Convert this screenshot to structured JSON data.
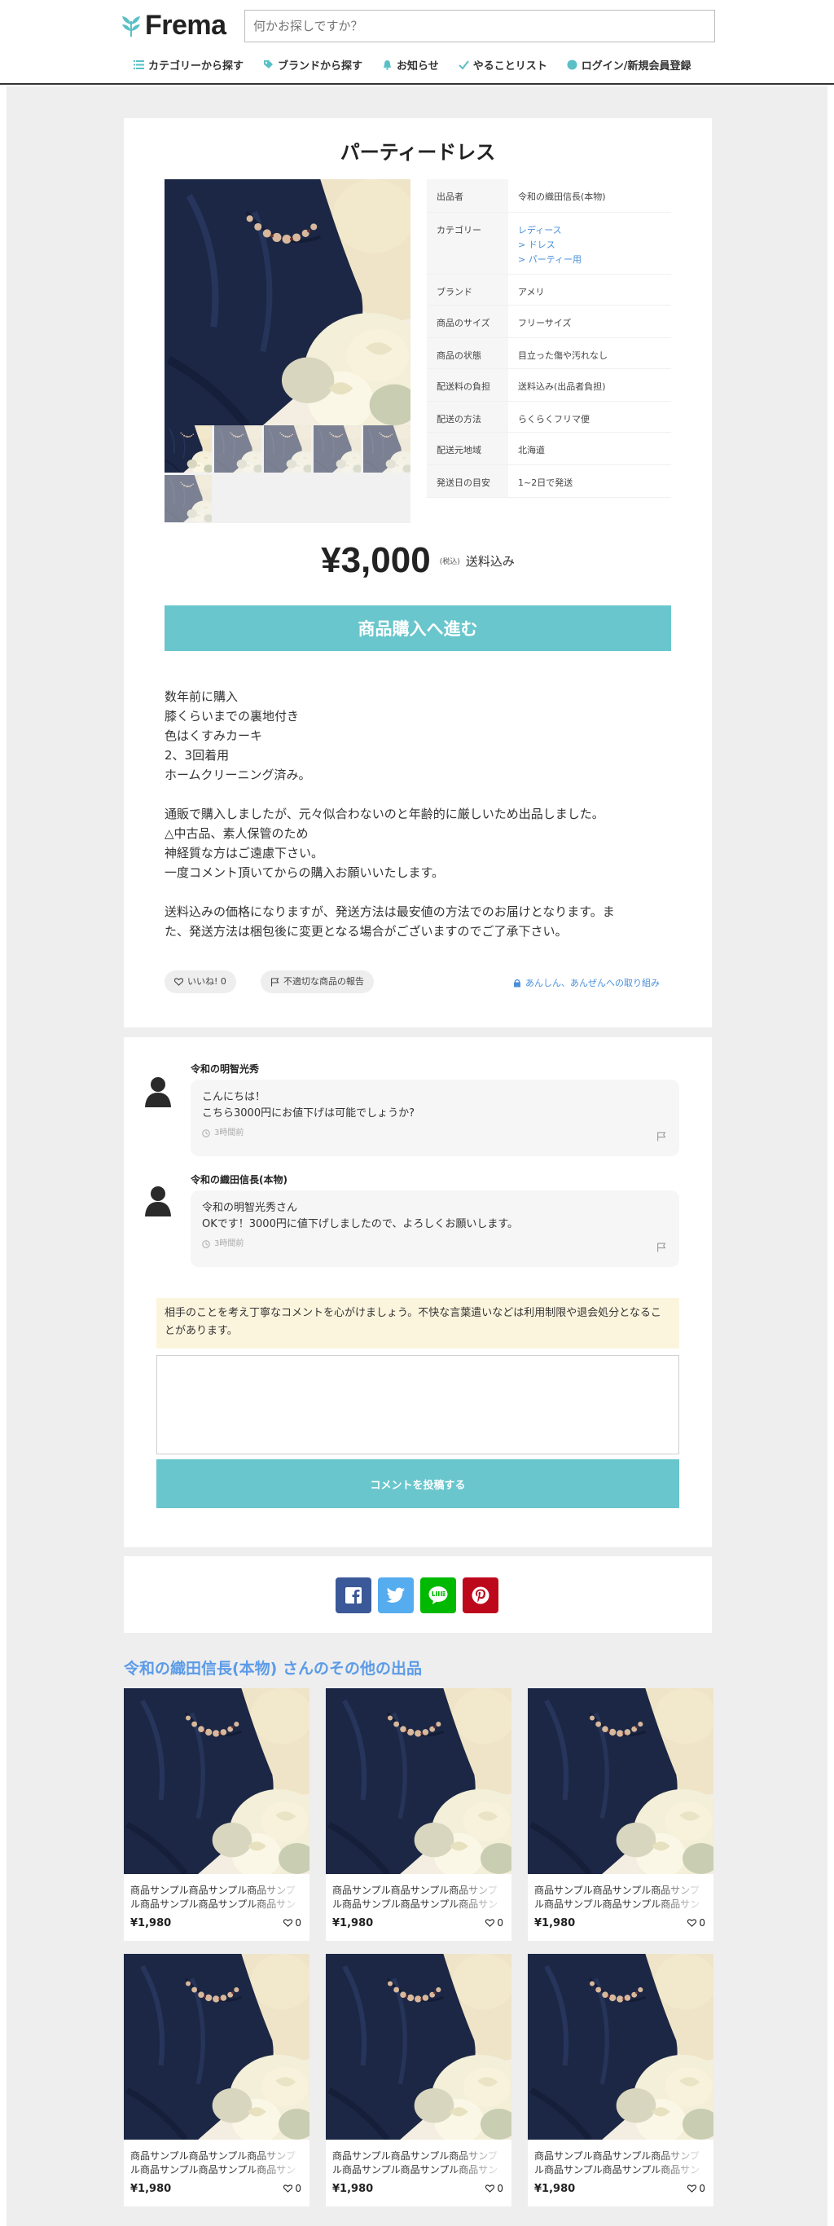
{
  "header": {
    "logo_text": "Frema",
    "search_placeholder": "何かお探しですか？",
    "nav": [
      {
        "label": "カテゴリーから探す"
      },
      {
        "label": "ブランドから探す"
      },
      {
        "label": "お知らせ"
      },
      {
        "label": "やることリスト"
      },
      {
        "label": "ログイン/新規会員登録"
      }
    ]
  },
  "product": {
    "title": "パーティードレス",
    "specs": [
      {
        "label": "出品者",
        "value": "令和の織田信長(本物)"
      },
      {
        "label": "カテゴリー",
        "links": [
          "レディース",
          "ドレス",
          "パーティー用"
        ]
      },
      {
        "label": "ブランド",
        "value": "アメリ"
      },
      {
        "label": "商品のサイズ",
        "value": "フリーサイズ"
      },
      {
        "label": "商品の状態",
        "value": "目立った傷や汚れなし"
      },
      {
        "label": "配送料の負担",
        "value": "送料込み(出品者負担)"
      },
      {
        "label": "配送の方法",
        "value": "らくらくフリマ便"
      },
      {
        "label": "配送元地域",
        "value": "北海道"
      },
      {
        "label": "発送日の目安",
        "value": "1~2日で発送"
      }
    ],
    "price": "¥3,000",
    "tax_label": "(税込)",
    "shipping_label": "送料込み",
    "buy_button": "商品購入へ進む",
    "description": [
      "数年前に購入",
      "膝くらいまでの裏地付き",
      "色はくすみカーキ",
      "2、3回着用",
      "ホームクリーニング済み。",
      "",
      "通販で購入しましたが、元々似合わないのと年齢的に厳しいため出品しました。",
      "△中古品、素人保管のため",
      "神経質な方はご遠慮下さい。",
      "一度コメント頂いてからの購入お願いいたします。",
      "",
      "送料込みの価格になりますが、発送方法は最安値の方法でのお届けとなります。ま",
      "た、発送方法は梱包後に変更となる場合がございますのでご了承下さい。"
    ],
    "like_label": "いいね! 0",
    "report_label": "不適切な商品の報告",
    "safe_label": "あんしん、あんぜんへの取り組み"
  },
  "comments": [
    {
      "name": "令和の明智光秀",
      "lines": [
        "こんにちは！",
        "こちら3000円にお値下げは可能でしょうか?"
      ],
      "time": "3時間前"
    },
    {
      "name": "令和の織田信長(本物)",
      "lines": [
        "令和の明智光秀さん",
        "OKです！3000円に値下げしましたので、よろしくお願いします。"
      ],
      "time": "3時間前"
    }
  ],
  "comment_form": {
    "notice": "相手のことを考え丁寧なコメントを心がけましょう。不快な言葉遣いなどは利用制限や退会処分となることがあります。",
    "submit_label": "コメントを投稿する"
  },
  "share": {
    "buttons": [
      {
        "icon": "facebook-icon",
        "color": "#3b5998"
      },
      {
        "icon": "twitter-icon",
        "color": "#55acee"
      },
      {
        "icon": "line-icon",
        "color": "#00b900"
      },
      {
        "icon": "pinterest-icon",
        "color": "#bd081c"
      }
    ]
  },
  "other_listings": {
    "title": "令和の織田信長(本物) さんのその他の出品",
    "items": [
      {
        "name": "商品サンプル商品サンプル商品サンプル商品サンプル商品サンプル商品サンプル",
        "price": "¥1,980",
        "likes": "0"
      },
      {
        "name": "商品サンプル商品サンプル商品サンプル商品サンプル商品サンプル商品サンプル",
        "price": "¥1,980",
        "likes": "0"
      },
      {
        "name": "商品サンプル商品サンプル商品サンプル商品サンプル商品サンプル商品サンプル",
        "price": "¥1,980",
        "likes": "0"
      },
      {
        "name": "商品サンプル商品サンプル商品サンプル商品サンプル商品サンプル商品サンプル",
        "price": "¥1,980",
        "likes": "0"
      },
      {
        "name": "商品サンプル商品サンプル商品サンプル商品サンプル商品サンプル商品サンプル",
        "price": "¥1,980",
        "likes": "0"
      },
      {
        "name": "商品サンプル商品サンプル商品サンプル商品サンプル商品サンプル商品サンプル",
        "price": "¥1,980",
        "likes": "0"
      }
    ]
  },
  "colors": {
    "accent": "#69c6cc",
    "link": "#4a90d9",
    "title_blue": "#5b9be8",
    "notice_bg": "#fcf5de"
  }
}
